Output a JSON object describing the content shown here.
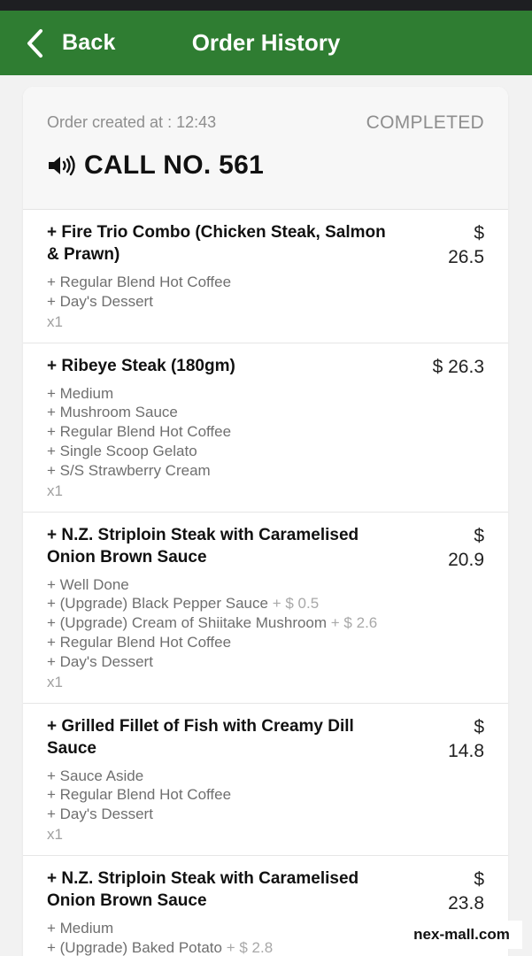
{
  "header": {
    "back_label": "Back",
    "title": "Order History"
  },
  "order": {
    "created_label": "Order created at : 12:43",
    "status": "COMPLETED",
    "call_number": "CALL NO. 561"
  },
  "items": [
    {
      "name": "+ Fire Trio Combo (Chicken Steak, Salmon & Prawn)",
      "price_currency": "$",
      "price_value": "26.5",
      "options": [
        {
          "text": "+ Regular Blend Hot Coffee",
          "extra": ""
        },
        {
          "text": "+ Day's Dessert",
          "extra": ""
        }
      ],
      "qty": "x1"
    },
    {
      "name": "+ Ribeye Steak (180gm)",
      "price_currency": "$",
      "price_value": "26.3",
      "options": [
        {
          "text": "+ Medium",
          "extra": ""
        },
        {
          "text": "+ Mushroom Sauce",
          "extra": ""
        },
        {
          "text": "+ Regular Blend Hot Coffee",
          "extra": ""
        },
        {
          "text": "+ Single Scoop Gelato",
          "extra": ""
        },
        {
          "text": "+ S/S Strawberry Cream",
          "extra": ""
        }
      ],
      "qty": "x1"
    },
    {
      "name": "+ N.Z. Striploin Steak with Caramelised Onion Brown Sauce",
      "price_currency": "$",
      "price_value": "20.9",
      "options": [
        {
          "text": "+ Well Done",
          "extra": ""
        },
        {
          "text": "+ (Upgrade) Black Pepper Sauce",
          "extra": "+ $ 0.5"
        },
        {
          "text": "+ (Upgrade) Cream of Shiitake Mushroom",
          "extra": "+ $ 2.6"
        },
        {
          "text": "+ Regular Blend Hot Coffee",
          "extra": ""
        },
        {
          "text": "+ Day's Dessert",
          "extra": ""
        }
      ],
      "qty": "x1"
    },
    {
      "name": "+ Grilled Fillet of Fish with Creamy Dill Sauce",
      "price_currency": "$",
      "price_value": "14.8",
      "options": [
        {
          "text": "+ Sauce Aside",
          "extra": ""
        },
        {
          "text": "+ Regular Blend Hot Coffee",
          "extra": ""
        },
        {
          "text": "+ Day's Dessert",
          "extra": ""
        }
      ],
      "qty": "x1"
    },
    {
      "name": "+ N.Z. Striploin Steak with Caramelised Onion Brown Sauce",
      "price_currency": "$",
      "price_value": "23.8",
      "options": [
        {
          "text": "+ Medium",
          "extra": ""
        },
        {
          "text": "+ (Upgrade) Baked Potato",
          "extra": "+ $ 2.8"
        }
      ],
      "qty": ""
    }
  ],
  "watermark": "nex-mall.com",
  "icons": {
    "back": "chevron-left-icon",
    "call": "speaker-icon"
  },
  "colors": {
    "appbar": "#2f7d32",
    "background": "#f2f2f2",
    "card": "#ffffff"
  }
}
